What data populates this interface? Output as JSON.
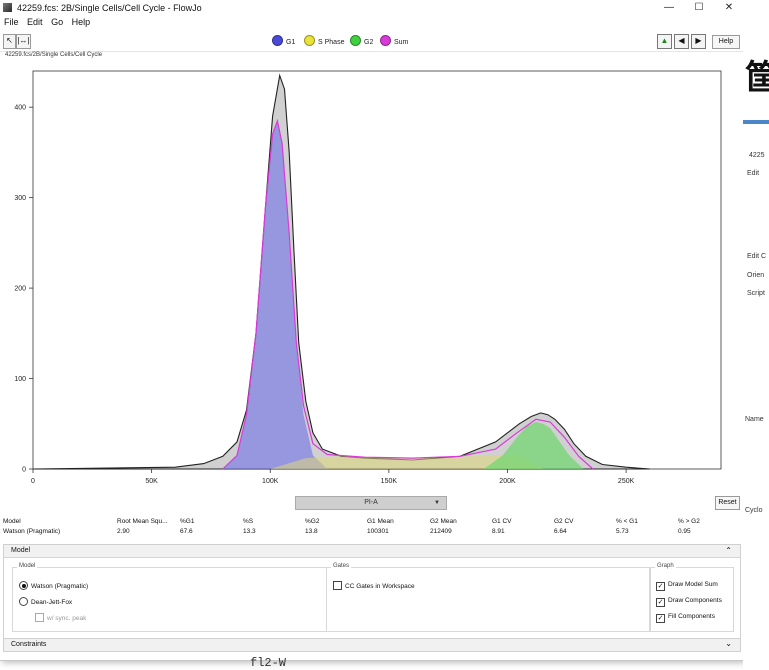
{
  "window": {
    "title": "42259.fcs: 2B/Single Cells/Cell Cycle - FlowJo",
    "buttons": {
      "minimize": "—",
      "maximize": "☐",
      "close": "✕"
    }
  },
  "menu": [
    "File",
    "Edit",
    "Go",
    "Help"
  ],
  "toolbar": {
    "legend": [
      {
        "label": "G1",
        "color": "#4a4ad8"
      },
      {
        "label": "S Phase",
        "color": "#e8e23a"
      },
      {
        "label": "G2",
        "color": "#3fcf3f"
      },
      {
        "label": "Sum",
        "color": "#d83ad8"
      }
    ],
    "help": "Help"
  },
  "breadcrumb": "42259.fcs/2B/Single Cells/Cell Cycle",
  "axis": {
    "x_ticks": [
      "0",
      "50K",
      "100K",
      "150K",
      "200K",
      "250K"
    ],
    "y_ticks": [
      "0",
      "100",
      "200",
      "300",
      "400"
    ]
  },
  "parameter_dropdown": "PI-A",
  "reset": "Reset",
  "stats": {
    "headers": [
      "Model",
      "Root Mean Squ...",
      "%G1",
      "%S",
      "%G2",
      "G1 Mean",
      "G2 Mean",
      "G1 CV",
      "G2 CV",
      "% < G1",
      "% > G2"
    ],
    "row": [
      "Watson (Pragmatic)",
      "2.90",
      "67.6",
      "13.3",
      "13.8",
      "100301",
      "212409",
      "8.91",
      "6.64",
      "5.73",
      "0.95"
    ]
  },
  "model_panel": {
    "title": "Model",
    "model_group": "Model",
    "opt_watson": "Watson (Pragmatic)",
    "opt_dean": "Dean-Jett-Fox",
    "opt_sync": "w/ sync. peak",
    "gates_group": "Gates",
    "opt_cc_gates": "CC Gates in Workspace",
    "graph_group": "Graph",
    "opt_draw_sum": "Draw Model Sum",
    "opt_draw_comp": "Draw Components",
    "opt_fill_comp": "Fill Components"
  },
  "constraints": "Constraints",
  "chart_data": {
    "type": "area",
    "xlim": [
      0,
      290000
    ],
    "ylim": [
      0,
      440
    ],
    "x_ticks": [
      0,
      50000,
      100000,
      150000,
      200000,
      250000
    ],
    "y_ticks": [
      0,
      100,
      200,
      300,
      400
    ],
    "grid": false,
    "legend": "top-center",
    "series": [
      {
        "name": "",
        "color": "#c8c8c8",
        "x": [
          0,
          60000,
          72000,
          80000,
          86000,
          90000,
          94000,
          98000,
          101000,
          104000,
          106000,
          108000,
          110000,
          112000,
          115000,
          118000,
          122000,
          130000,
          140000,
          160000,
          180000,
          195000,
          205000,
          210000,
          214000,
          217000,
          220000,
          224000,
          228000,
          233000,
          240000,
          250000,
          260000
        ],
        "y": [
          0,
          2,
          6,
          14,
          30,
          65,
          150,
          290,
          390,
          435,
          420,
          350,
          240,
          140,
          75,
          40,
          22,
          14,
          12,
          10,
          14,
          30,
          50,
          58,
          62,
          60,
          55,
          44,
          28,
          14,
          5,
          2,
          0
        ]
      },
      {
        "name": "G1",
        "color": "#4a4ad8",
        "x": [
          80000,
          86000,
          90000,
          94000,
          98000,
          101000,
          103000,
          105000,
          108000,
          111000,
          114000,
          118000,
          124000
        ],
        "y": [
          0,
          15,
          60,
          150,
          290,
          370,
          385,
          360,
          260,
          140,
          60,
          15,
          0
        ]
      },
      {
        "name": "S Phase",
        "color": "#e8e23a",
        "x": [
          100000,
          115000,
          130000,
          150000,
          170000,
          190000,
          205000,
          215000
        ],
        "y": [
          0,
          12,
          14,
          13,
          12,
          15,
          16,
          0
        ]
      },
      {
        "name": "G2",
        "color": "#3fcf3f",
        "x": [
          190000,
          198000,
          204000,
          208000,
          212000,
          215000,
          218000,
          222000,
          226000,
          232000
        ],
        "y": [
          0,
          15,
          35,
          47,
          52,
          50,
          45,
          30,
          15,
          0
        ]
      },
      {
        "name": "Sum",
        "color": "#d83ad8",
        "x": [
          80000,
          86000,
          90000,
          94000,
          98000,
          101000,
          103000,
          105000,
          108000,
          111000,
          114000,
          118000,
          124000,
          140000,
          160000,
          180000,
          195000,
          204000,
          212000,
          218000,
          224000,
          230000,
          236000
        ],
        "y": [
          0,
          15,
          60,
          150,
          290,
          370,
          385,
          360,
          260,
          140,
          70,
          28,
          16,
          13,
          12,
          14,
          22,
          40,
          55,
          52,
          35,
          14,
          0
        ]
      }
    ]
  },
  "background_window": {
    "fragments": [
      "4225",
      "Edit",
      "Edit C",
      "Orien",
      "Script",
      "Name",
      "Cyclo"
    ],
    "behind_text": "fl2-W"
  }
}
